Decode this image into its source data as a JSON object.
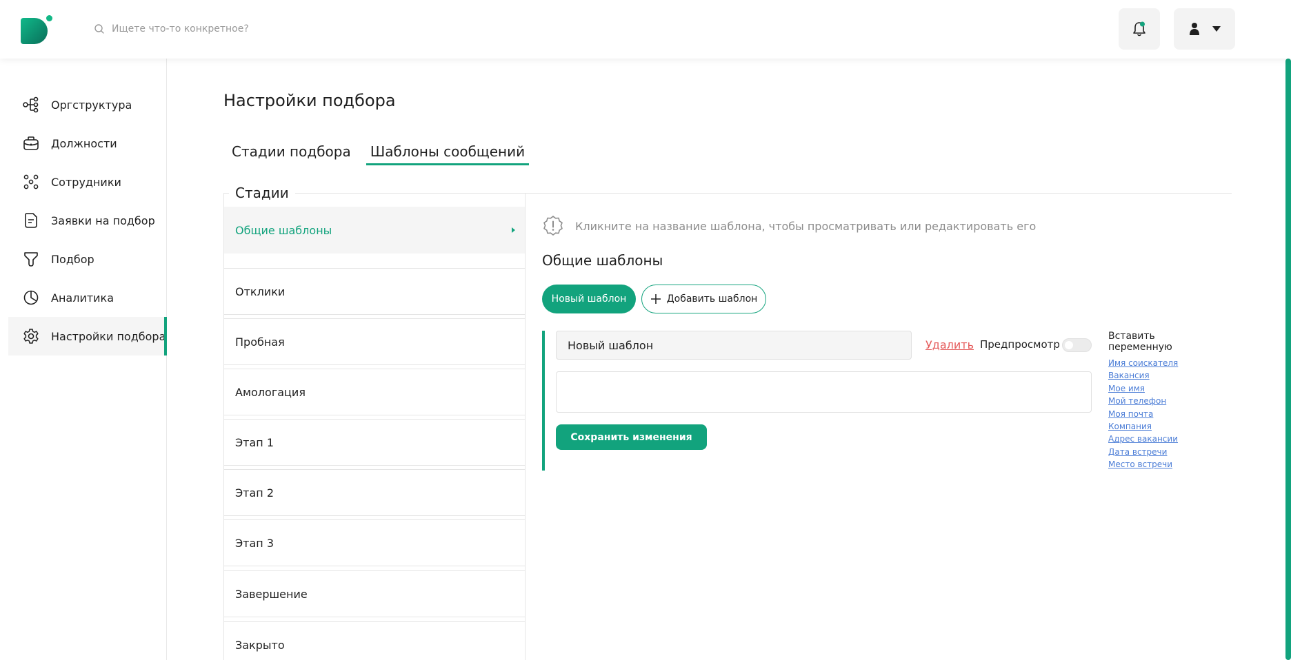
{
  "header": {
    "search_placeholder": "Ищете что-то конкретное?"
  },
  "sidebar": {
    "items": [
      {
        "label": "Оргструктура",
        "icon": "org-structure-icon"
      },
      {
        "label": "Должности",
        "icon": "briefcase-icon"
      },
      {
        "label": "Сотрудники",
        "icon": "people-icon"
      },
      {
        "label": "Заявки на подбор",
        "icon": "document-icon"
      },
      {
        "label": "Подбор",
        "icon": "funnel-icon"
      },
      {
        "label": "Аналитика",
        "icon": "pie-chart-icon"
      },
      {
        "label": "Настройки подбора",
        "icon": "gear-icon",
        "active": true
      }
    ]
  },
  "main": {
    "title": "Настройки подбора",
    "tabs": [
      {
        "label": "Стадии подбора"
      },
      {
        "label": "Шаблоны сообщений",
        "active": true
      }
    ],
    "stages_legend": "Стадии",
    "stages": [
      {
        "label": "Общие шаблоны",
        "active": true
      },
      {
        "label": "Отклики"
      },
      {
        "label": "Пробная"
      },
      {
        "label": "Амологация"
      },
      {
        "label": "Этап 1"
      },
      {
        "label": "Этап 2"
      },
      {
        "label": "Этап 3"
      },
      {
        "label": "Завершение"
      },
      {
        "label": "Закрыто"
      }
    ]
  },
  "panel": {
    "hint": "Кликните на название шаблона, чтобы просматривать или редактировать его",
    "section_title": "Общие шаблоны",
    "new_template_button": "Новый шаблон",
    "add_template_button": "Добавить шаблон",
    "template_name_value": "Новый шаблон",
    "delete_link": "Удалить",
    "preview_label": "Предпросмотр",
    "preview_enabled": false,
    "template_body_value": "",
    "save_button": "Сохранить изменения",
    "variables_title": "Вставить переменную",
    "variables": [
      "Имя соискателя",
      "Вакансия",
      "Мое имя",
      "Мой телефон",
      "Моя почта",
      "Компания",
      "Адрес вакансии",
      "Дата встречи",
      "Место встречи"
    ]
  },
  "colors": {
    "accent": "#12a37d",
    "danger": "#e55b5b",
    "link": "#4a7cd6",
    "muted_text": "#8c8c8c"
  }
}
